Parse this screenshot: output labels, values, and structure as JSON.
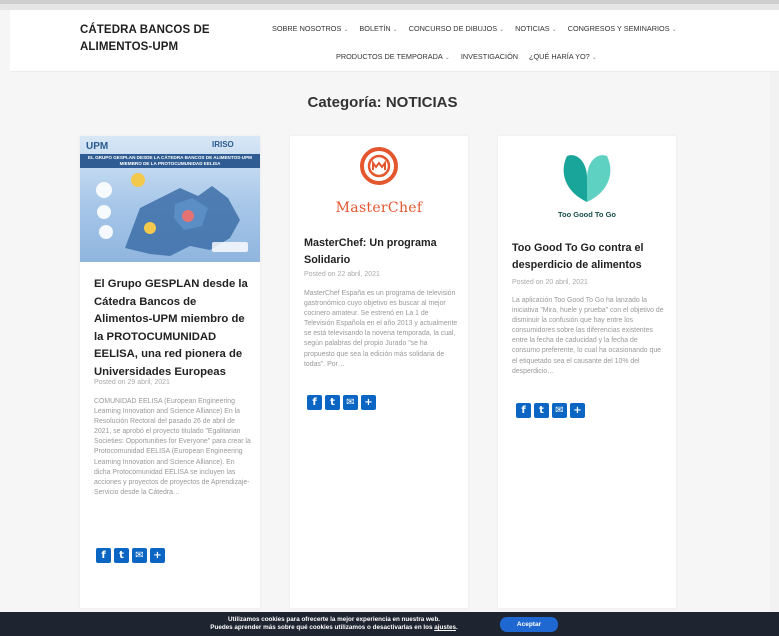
{
  "header": {
    "brand": "CÁTEDRA BANCOS DE ALIMENTOS-UPM",
    "nav_row1": [
      {
        "label": "SOBRE NOSOTROS",
        "chevron": true
      },
      {
        "label": "BOLETÍN",
        "chevron": true
      },
      {
        "label": "CONCURSO DE DIBUJOS",
        "chevron": true
      },
      {
        "label": "NOTICIAS",
        "chevron": true
      },
      {
        "label": "CONGRESOS Y SEMINARIOS",
        "chevron": true
      }
    ],
    "nav_row2": [
      {
        "label": "PRODUCTOS DE TEMPORADA",
        "chevron": true
      },
      {
        "label": "INVESTIGACIÓN",
        "chevron": false
      },
      {
        "label": "¿QUÉ HARÍA YO?",
        "chevron": true
      }
    ]
  },
  "page": {
    "title": "Categoría: NOTICIAS"
  },
  "posts": [
    {
      "title": "El Grupo GESPLAN desde la Cátedra Bancos de Alimentos-UPM miembro de la PROTOCUMUNIDAD EELISA, una red pionera de Universidades Europeas",
      "posted": "Posted on 29 abril, 2021",
      "excerpt": "COMUNIDAD EELISA (European Engineering Learning Innovation and Science Alliance) En la Resolución Rectoral del pasado 26 de abril de 2021, se aprobó el proyecto titulado \"Egalitarian Societies: Opportunities for Everyone\" para crear la Protocomunidad EELISA (European Engineering Learning Innovation and Science Alliance). En dicha Protocomunidad EELISA se incluyen las acciones y proyectos de proyectos de Aprendizaje-Servicio desde la Cátedra…",
      "thumb_band_text": "EL GRUPO GESPLAN DESDE LA CÁTEDRA BANCOS DE ALIMENTOS-UPM MIEMBRO DE LA PROTOCUMUNIDAD EELISA",
      "thumb_logo_left": "UPM",
      "thumb_logo_right": "IRISO"
    },
    {
      "title": "MasterChef: Un programa Solidario",
      "posted": "Posted on 22 abril, 2021",
      "excerpt": "MasterChef España es un programa de televisión gastronómico cuyo objetivo es buscar al mejor cocinero amateur. Se estrenó en La 1 de Televisión Española en el año 2013 y actualmente se está televisando la novena temporada, la cual, según palabras del propio Jurado \"se ha propuesto que sea la edición más solidaria de todas\". Por…",
      "logo_text": "MasterChef"
    },
    {
      "title": "Too Good To Go contra el desperdicio de alimentos",
      "posted": "Posted on 20 abril, 2021",
      "excerpt": "La aplicación Too Good To Go ha lanzado la iniciativa \"Mira, huele y prueba\" con el objetivo de disminuir la confusión que hay entre los consumidores sobre las diferencias existentes entre la fecha de caducidad y la fecha de consumo preferente, lo cual ha ocasionando que el etiquetado sea el causante del 10% del desperdicio…",
      "logo_text": "Too Good To Go"
    }
  ],
  "share_icons": [
    "facebook-icon",
    "twitter-icon",
    "email-icon",
    "add-icon"
  ],
  "share_glyphs": {
    "f": "f",
    "t": "t",
    "e": "✉",
    "p": "+"
  },
  "cookie": {
    "line1": "Utilizamos cookies para ofrecerte la mejor experiencia en nuestra web.",
    "line2_prefix": "Puedes aprender más sobre qué cookies utilizamos o desactivarlas en los",
    "line2_link": "ajustes",
    "line2_suffix": ".",
    "accept_label": "Aceptar"
  },
  "colors": {
    "share_blue": "#0a66c2",
    "masterchef_orange": "#e4572e",
    "tgtg_teal": "#1aa59a",
    "cookie_bg": "#1e2430",
    "accept_blue": "#1f68d2"
  }
}
